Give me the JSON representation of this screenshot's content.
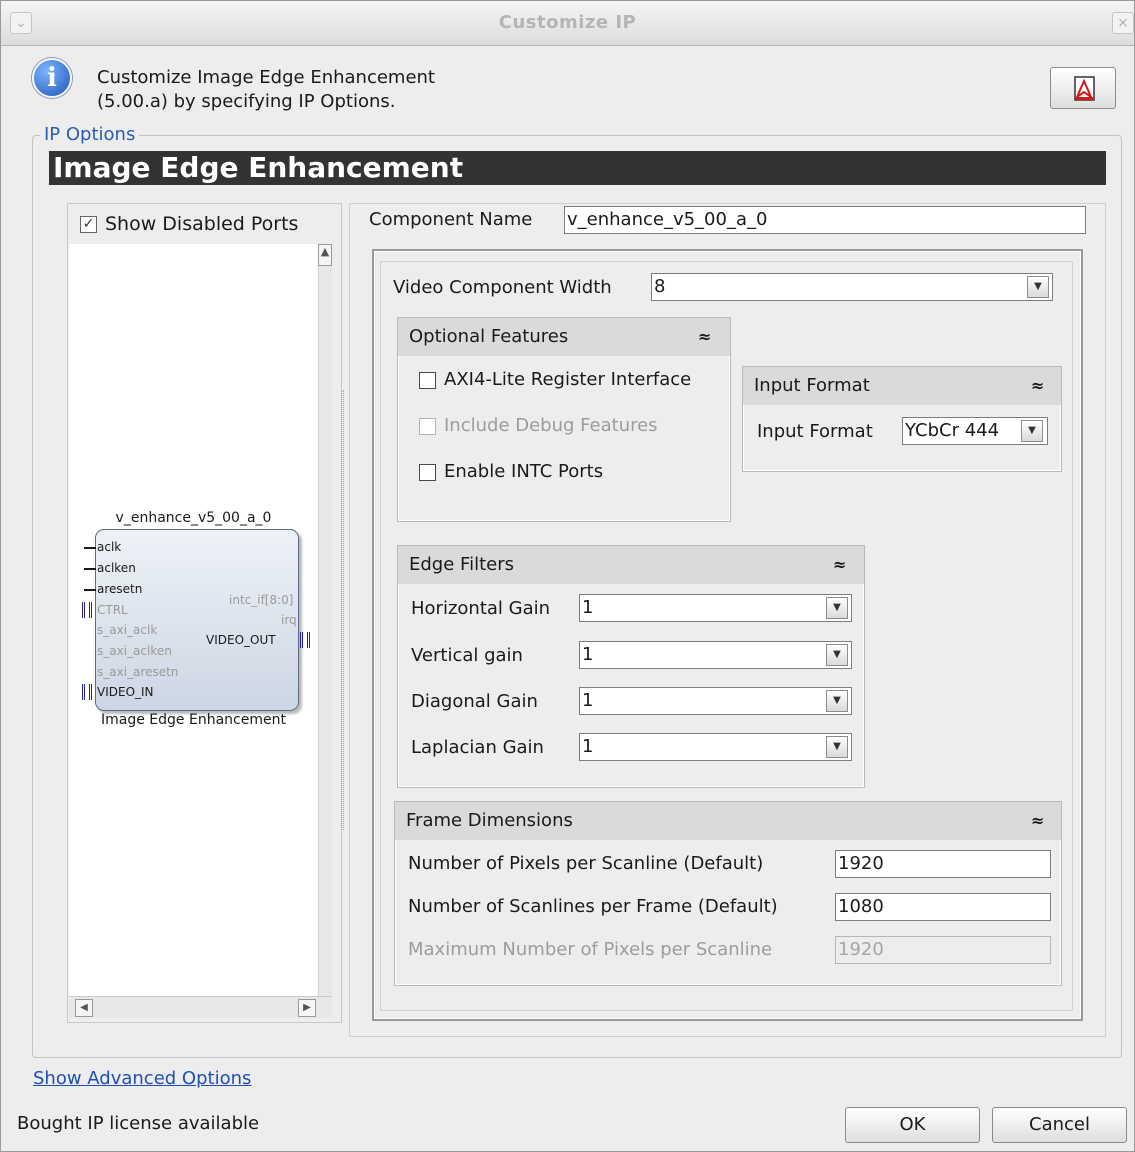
{
  "window": {
    "title": "Customize IP",
    "menu_glyph": "⌄",
    "close_glyph": "×"
  },
  "header": {
    "icon": "info-icon",
    "icon_glyph": "i",
    "description_line1": "Customize Image Edge Enhancement",
    "description_line2": "(5.00.a) by specifying IP Options.",
    "pdf_icon": "pdf-document-icon"
  },
  "ip_options": {
    "legend": "IP Options",
    "banner_title": "Image Edge Enhancement"
  },
  "symbol_panel": {
    "show_disabled_ports_label": "Show Disabled Ports",
    "show_disabled_ports_checked": true,
    "instance_name": "v_enhance_v5_00_a_0",
    "caption": "Image Edge Enhancement",
    "left_ports": [
      "aclk",
      "aclken",
      "aresetn",
      "CTRL",
      "s_axi_aclk",
      "s_axi_aclken",
      "s_axi_aresetn",
      "VIDEO_IN"
    ],
    "right_ports": [
      "intc_if[8:0]",
      "irq",
      "VIDEO_OUT"
    ]
  },
  "component": {
    "name_label": "Component Name",
    "name_value": "v_enhance_v5_00_a_0"
  },
  "video_width": {
    "label": "Video Component Width",
    "value": "8"
  },
  "optional_features": {
    "title": "Optional Features",
    "items": [
      {
        "label": "AXI4-Lite Register Interface",
        "checked": false,
        "enabled": true
      },
      {
        "label": "Include Debug Features",
        "checked": false,
        "enabled": false
      },
      {
        "label": "Enable INTC Ports",
        "checked": false,
        "enabled": true
      }
    ]
  },
  "input_format": {
    "title": "Input Format",
    "label": "Input Format",
    "value": "YCbCr 444"
  },
  "edge_filters": {
    "title": "Edge Filters",
    "rows": [
      {
        "label": "Horizontal Gain",
        "value": "1"
      },
      {
        "label": "Vertical gain",
        "value": "1"
      },
      {
        "label": "Diagonal Gain",
        "value": "1"
      },
      {
        "label": "Laplacian Gain",
        "value": "1"
      }
    ]
  },
  "frame_dimensions": {
    "title": "Frame Dimensions",
    "rows": [
      {
        "label": "Number of Pixels per Scanline (Default)",
        "value": "1920",
        "enabled": true
      },
      {
        "label": "Number of Scanlines per Frame (Default)",
        "value": "1080",
        "enabled": true
      },
      {
        "label": "Maximum Number of Pixels per Scanline",
        "value": "1920",
        "enabled": false
      }
    ]
  },
  "footer": {
    "advanced_link": "Show Advanced Options",
    "license_text": "Bought IP license available",
    "ok_label": "OK",
    "cancel_label": "Cancel"
  },
  "glyphs": {
    "collapse": "≈",
    "dropdown": "▼",
    "scroll_left": "◀",
    "scroll_right": "▶",
    "scroll_up": "▲",
    "checkmark": "✓"
  },
  "colors": {
    "banner_bg": "#333333",
    "link": "#1f4fb4",
    "legend": "#2a5db0",
    "group_header": "#dadada"
  }
}
